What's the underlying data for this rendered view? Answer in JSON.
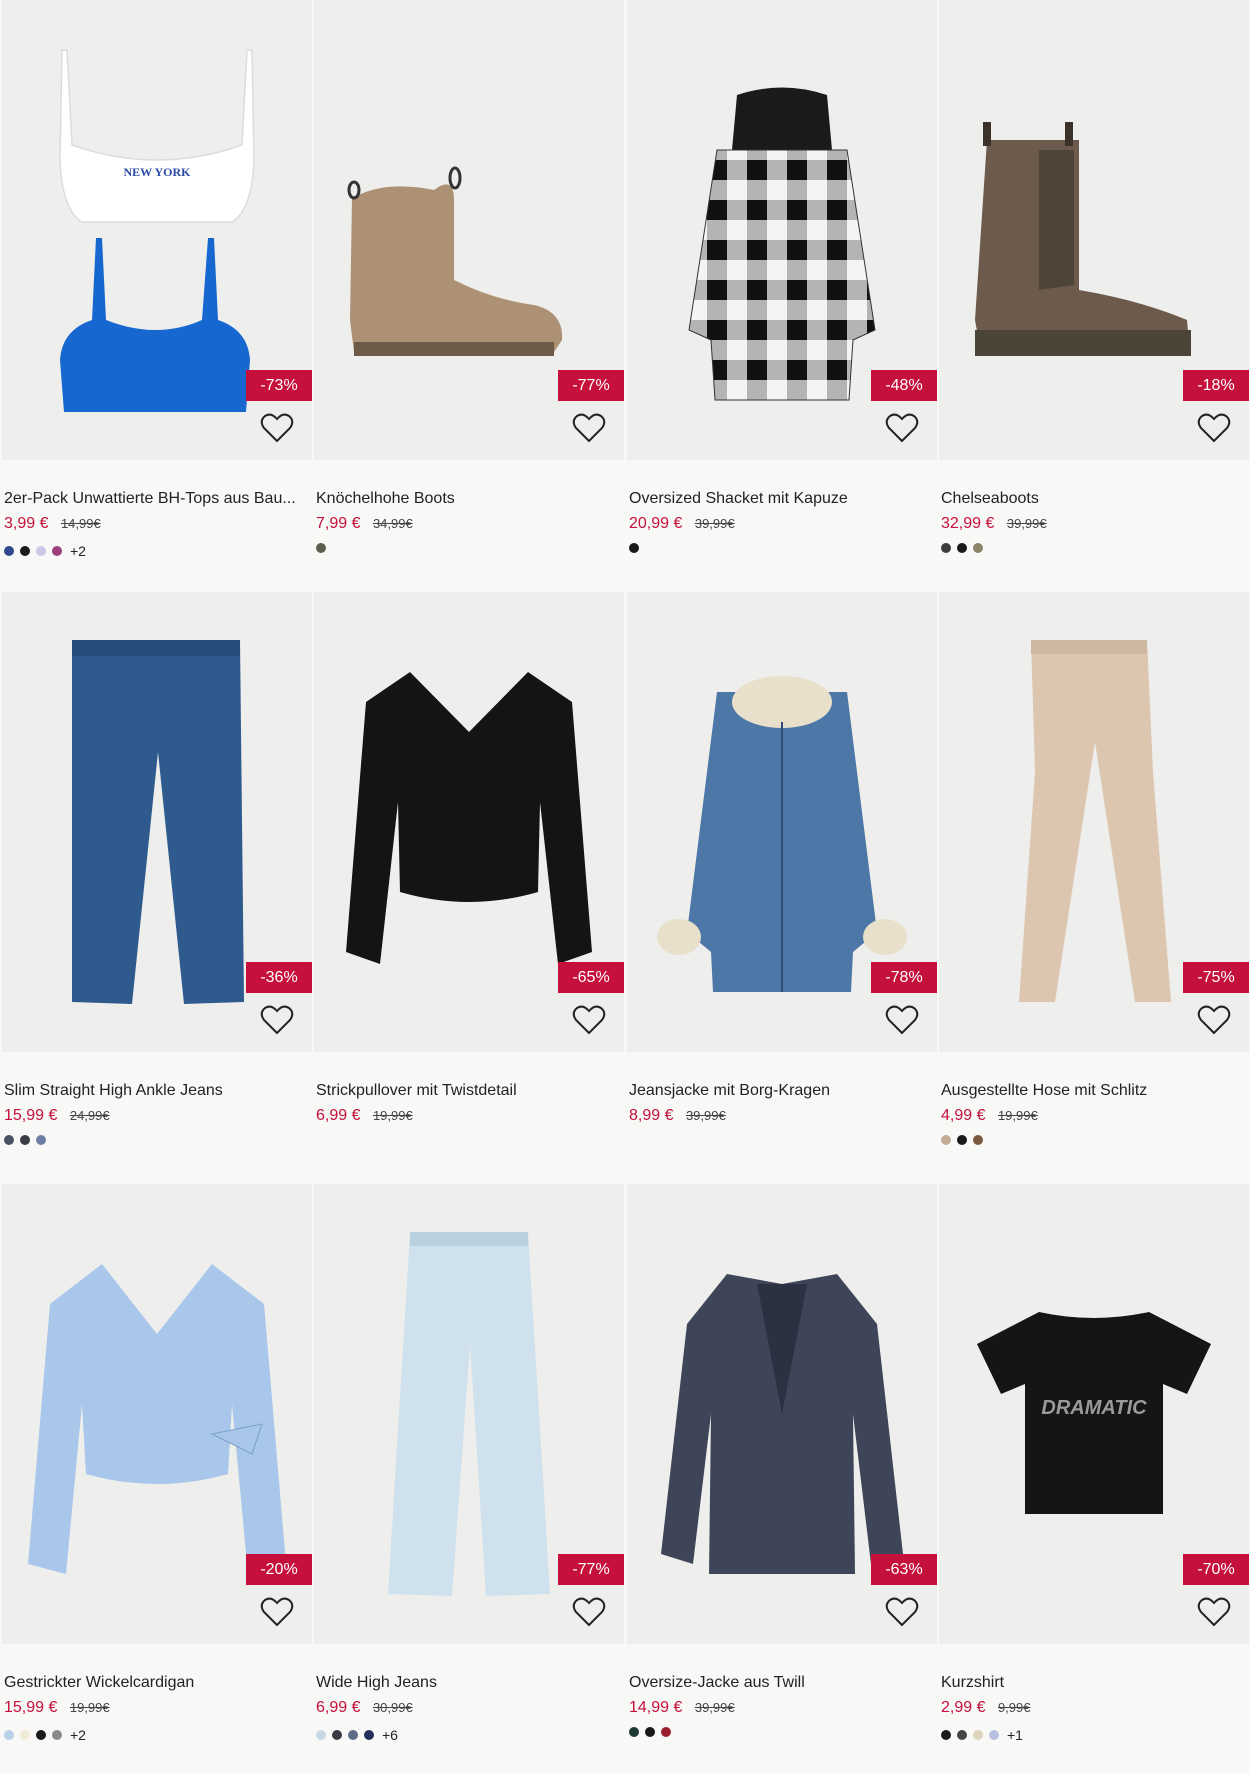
{
  "products": [
    {
      "title": "2er-Pack Unwattierte BH-Tops aus Bau...",
      "price": "3,99 €",
      "old_price": "14,99€",
      "discount": "-73%",
      "swatches": [
        "#2e4a8c",
        "#1a1a1a",
        "#c9c7e6",
        "#9c3d7e"
      ],
      "more": "+2",
      "icon": "crop-top-icon"
    },
    {
      "title": "Knöchelhohe Boots",
      "price": "7,99 €",
      "old_price": "34,99€",
      "discount": "-77%",
      "swatches": [
        "#5e5e4e"
      ],
      "more": "",
      "icon": "ankle-boot-icon"
    },
    {
      "title": "Oversized Shacket mit Kapuze",
      "price": "20,99 €",
      "old_price": "39,99€",
      "discount": "-48%",
      "swatches": [
        "#1a1a1a"
      ],
      "more": "",
      "icon": "plaid-jacket-icon"
    },
    {
      "title": "Chelseaboots",
      "price": "32,99 €",
      "old_price": "39,99€",
      "discount": "-18%",
      "swatches": [
        "#3c3c3c",
        "#1a1a1a",
        "#8a8468"
      ],
      "more": "",
      "icon": "chelsea-boot-icon"
    },
    {
      "title": "Slim Straight High Ankle Jeans",
      "price": "15,99 €",
      "old_price": "24,99€",
      "discount": "-36%",
      "swatches": [
        "#4a5262",
        "#3a3c44",
        "#6e7fa6"
      ],
      "more": "",
      "icon": "jeans-icon"
    },
    {
      "title": "Strickpullover mit Twistdetail",
      "price": "6,99 €",
      "old_price": "19,99€",
      "discount": "-65%",
      "swatches": [],
      "more": "",
      "icon": "sweater-icon"
    },
    {
      "title": "Jeansjacke mit Borg-Kragen",
      "price": "8,99 €",
      "old_price": "39,99€",
      "discount": "-78%",
      "swatches": [],
      "more": "",
      "icon": "denim-jacket-icon"
    },
    {
      "title": "Ausgestellte Hose mit Schlitz",
      "price": "4,99 €",
      "old_price": "19,99€",
      "discount": "-75%",
      "swatches": [
        "#c4ad96",
        "#1a1a1a",
        "#7a5840"
      ],
      "more": "",
      "icon": "trousers-icon"
    },
    {
      "title": "Gestrickter Wickelcardigan",
      "price": "15,99 €",
      "old_price": "19,99€",
      "discount": "-20%",
      "swatches": [
        "#b9cfe9",
        "#f1ecd8",
        "#1a1a1a",
        "#8a8a8a"
      ],
      "more": "+2",
      "icon": "cardigan-icon"
    },
    {
      "title": "Wide High Jeans",
      "price": "6,99 €",
      "old_price": "30,99€",
      "discount": "-77%",
      "swatches": [
        "#c6d8e6",
        "#3a3c44",
        "#5d6b88",
        "#24305a"
      ],
      "more": "+6",
      "icon": "wide-jeans-icon"
    },
    {
      "title": "Oversize-Jacke aus Twill",
      "price": "14,99 €",
      "old_price": "39,99€",
      "discount": "-63%",
      "swatches": [
        "#1f3a34",
        "#1a1a1a",
        "#9a1e2e"
      ],
      "more": "",
      "icon": "blazer-icon"
    },
    {
      "title": "Kurzshirt",
      "price": "2,99 €",
      "old_price": "9,99€",
      "discount": "-70%",
      "swatches": [
        "#1a1a1a",
        "#444444",
        "#dcd4bc",
        "#b8bfe0"
      ],
      "more": "+1",
      "icon": "tshirt-icon"
    }
  ],
  "tshirt_print": "DRAMATIC",
  "top_print": "NEW YORK"
}
